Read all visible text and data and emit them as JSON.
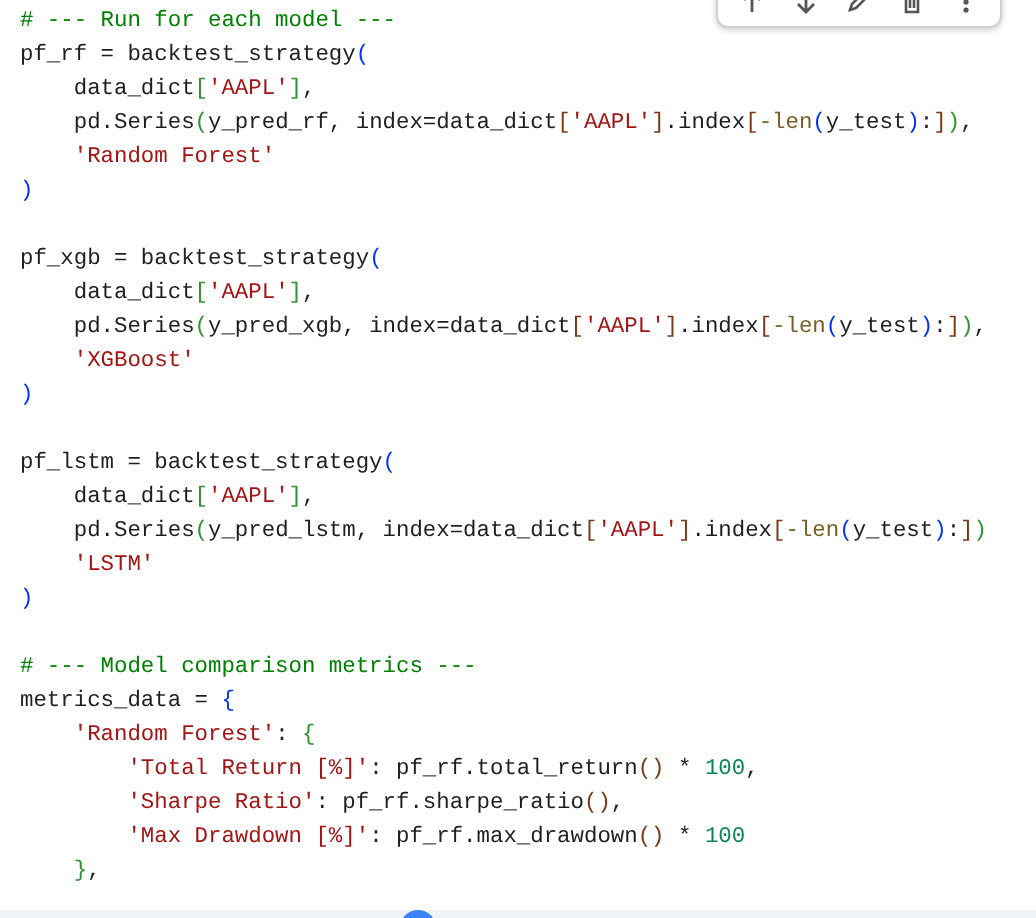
{
  "code_lines": [
    {
      "kind": "code",
      "tokens": [
        {
          "kind": "comment",
          "text": "# --- Run for each model ---"
        }
      ]
    },
    {
      "kind": "code",
      "tokens": [
        {
          "kind": "plain",
          "text": "pf_rf = backtest_strategy"
        },
        {
          "kind": "b1",
          "text": "("
        }
      ]
    },
    {
      "kind": "code",
      "tokens": [
        {
          "kind": "plain",
          "text": "    data_dict"
        },
        {
          "kind": "b2",
          "text": "["
        },
        {
          "kind": "string",
          "text": "'AAPL'"
        },
        {
          "kind": "b2",
          "text": "]"
        },
        {
          "kind": "plain",
          "text": ","
        }
      ]
    },
    {
      "kind": "code",
      "tokens": [
        {
          "kind": "plain",
          "text": "    pd.Series"
        },
        {
          "kind": "b2",
          "text": "("
        },
        {
          "kind": "plain",
          "text": "y_pred_rf, index=data_dict"
        },
        {
          "kind": "b3",
          "text": "["
        },
        {
          "kind": "string",
          "text": "'AAPL'"
        },
        {
          "kind": "b3",
          "text": "]"
        },
        {
          "kind": "plain",
          "text": ".index"
        },
        {
          "kind": "b3",
          "text": "["
        },
        {
          "kind": "func",
          "text": "-len"
        },
        {
          "kind": "b1",
          "text": "("
        },
        {
          "kind": "plain",
          "text": "y_test"
        },
        {
          "kind": "b1",
          "text": ")"
        },
        {
          "kind": "plain",
          "text": ":"
        },
        {
          "kind": "b3",
          "text": "]"
        },
        {
          "kind": "b2",
          "text": ")"
        },
        {
          "kind": "plain",
          "text": ","
        }
      ]
    },
    {
      "kind": "code",
      "tokens": [
        {
          "kind": "string",
          "text": "    'Random Forest'"
        }
      ]
    },
    {
      "kind": "code",
      "tokens": [
        {
          "kind": "b1",
          "text": ")"
        }
      ]
    },
    {
      "kind": "blank"
    },
    {
      "kind": "code",
      "tokens": [
        {
          "kind": "plain",
          "text": "pf_xgb = backtest_strategy"
        },
        {
          "kind": "b1",
          "text": "("
        }
      ]
    },
    {
      "kind": "code",
      "tokens": [
        {
          "kind": "plain",
          "text": "    data_dict"
        },
        {
          "kind": "b2",
          "text": "["
        },
        {
          "kind": "string",
          "text": "'AAPL'"
        },
        {
          "kind": "b2",
          "text": "]"
        },
        {
          "kind": "plain",
          "text": ","
        }
      ]
    },
    {
      "kind": "code",
      "tokens": [
        {
          "kind": "plain",
          "text": "    pd.Series"
        },
        {
          "kind": "b2",
          "text": "("
        },
        {
          "kind": "plain",
          "text": "y_pred_xgb, index=data_dict"
        },
        {
          "kind": "b3",
          "text": "["
        },
        {
          "kind": "string",
          "text": "'AAPL'"
        },
        {
          "kind": "b3",
          "text": "]"
        },
        {
          "kind": "plain",
          "text": ".index"
        },
        {
          "kind": "b3",
          "text": "["
        },
        {
          "kind": "func",
          "text": "-len"
        },
        {
          "kind": "b1",
          "text": "("
        },
        {
          "kind": "plain",
          "text": "y_test"
        },
        {
          "kind": "b1",
          "text": ")"
        },
        {
          "kind": "plain",
          "text": ":"
        },
        {
          "kind": "b3",
          "text": "]"
        },
        {
          "kind": "b2",
          "text": ")"
        },
        {
          "kind": "plain",
          "text": ","
        }
      ]
    },
    {
      "kind": "code",
      "tokens": [
        {
          "kind": "string",
          "text": "    'XGBoost'"
        }
      ]
    },
    {
      "kind": "code",
      "tokens": [
        {
          "kind": "b1",
          "text": ")"
        }
      ]
    },
    {
      "kind": "blank"
    },
    {
      "kind": "code",
      "tokens": [
        {
          "kind": "plain",
          "text": "pf_lstm = backtest_strategy"
        },
        {
          "kind": "b1",
          "text": "("
        }
      ]
    },
    {
      "kind": "code",
      "tokens": [
        {
          "kind": "plain",
          "text": "    data_dict"
        },
        {
          "kind": "b2",
          "text": "["
        },
        {
          "kind": "string",
          "text": "'AAPL'"
        },
        {
          "kind": "b2",
          "text": "]"
        },
        {
          "kind": "plain",
          "text": ","
        }
      ]
    },
    {
      "kind": "code",
      "tokens": [
        {
          "kind": "plain",
          "text": "    pd.Series"
        },
        {
          "kind": "b2",
          "text": "("
        },
        {
          "kind": "plain",
          "text": "y_pred_lstm, index=data_dict"
        },
        {
          "kind": "b3",
          "text": "["
        },
        {
          "kind": "string",
          "text": "'AAPL'"
        },
        {
          "kind": "b3",
          "text": "]"
        },
        {
          "kind": "plain",
          "text": ".index"
        },
        {
          "kind": "b3",
          "text": "["
        },
        {
          "kind": "func",
          "text": "-len"
        },
        {
          "kind": "b1",
          "text": "("
        },
        {
          "kind": "plain",
          "text": "y_test"
        },
        {
          "kind": "b1",
          "text": ")"
        },
        {
          "kind": "plain",
          "text": ":"
        },
        {
          "kind": "b3",
          "text": "]"
        },
        {
          "kind": "b2",
          "text": ")"
        }
      ]
    },
    {
      "kind": "code",
      "tokens": [
        {
          "kind": "string",
          "text": "    'LSTM'"
        }
      ]
    },
    {
      "kind": "code",
      "tokens": [
        {
          "kind": "b1",
          "text": ")"
        }
      ]
    },
    {
      "kind": "blank"
    },
    {
      "kind": "code",
      "tokens": [
        {
          "kind": "comment",
          "text": "# --- Model comparison metrics ---"
        }
      ]
    },
    {
      "kind": "code",
      "tokens": [
        {
          "kind": "plain",
          "text": "metrics_data = "
        },
        {
          "kind": "b1",
          "text": "{"
        }
      ]
    },
    {
      "kind": "code",
      "tokens": [
        {
          "kind": "string",
          "text": "    'Random Forest'"
        },
        {
          "kind": "plain",
          "text": ": "
        },
        {
          "kind": "b2",
          "text": "{"
        }
      ]
    },
    {
      "kind": "code",
      "tokens": [
        {
          "kind": "string",
          "text": "        'Total Return [%]'"
        },
        {
          "kind": "plain",
          "text": ": pf_rf.total_return"
        },
        {
          "kind": "b3",
          "text": "()"
        },
        {
          "kind": "plain",
          "text": " * "
        },
        {
          "kind": "number",
          "text": "100"
        },
        {
          "kind": "plain",
          "text": ","
        }
      ]
    },
    {
      "kind": "code",
      "tokens": [
        {
          "kind": "string",
          "text": "        'Sharpe Ratio'"
        },
        {
          "kind": "plain",
          "text": ": pf_rf.sharpe_ratio"
        },
        {
          "kind": "b3",
          "text": "()"
        },
        {
          "kind": "plain",
          "text": ","
        }
      ]
    },
    {
      "kind": "code",
      "tokens": [
        {
          "kind": "string",
          "text": "        'Max Drawdown [%]'"
        },
        {
          "kind": "plain",
          "text": ": pf_rf.max_drawdown"
        },
        {
          "kind": "b3",
          "text": "()"
        },
        {
          "kind": "plain",
          "text": " * "
        },
        {
          "kind": "number",
          "text": "100"
        }
      ]
    },
    {
      "kind": "code",
      "tokens": [
        {
          "kind": "b2",
          "text": "    }"
        },
        {
          "kind": "plain",
          "text": ","
        }
      ]
    }
  ]
}
